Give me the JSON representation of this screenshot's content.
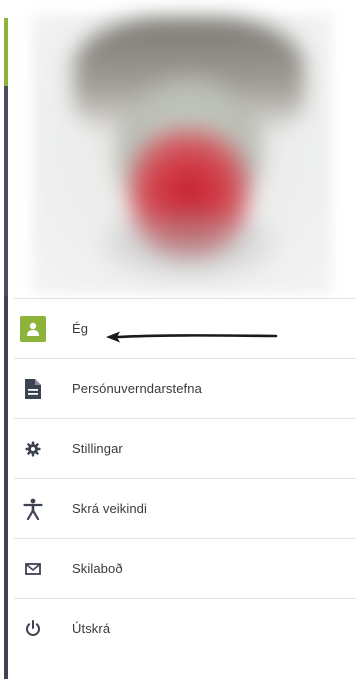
{
  "menu": {
    "items": [
      {
        "label": "Ég",
        "icon": "person-icon",
        "active": true
      },
      {
        "label": "Persónuverndarstefna",
        "icon": "document-icon"
      },
      {
        "label": "Stillingar",
        "icon": "gear-icon"
      },
      {
        "label": "Skrá veikindi",
        "icon": "accessibility-icon"
      },
      {
        "label": "Skilaboð",
        "icon": "envelope-icon"
      },
      {
        "label": "Útskrá",
        "icon": "power-icon"
      }
    ]
  },
  "colors": {
    "accent": "#8db33b",
    "sidebar_edge": "#3f4352",
    "icon": "#3d4250",
    "text": "#3a3a3a",
    "divider": "#e3e3e3"
  }
}
